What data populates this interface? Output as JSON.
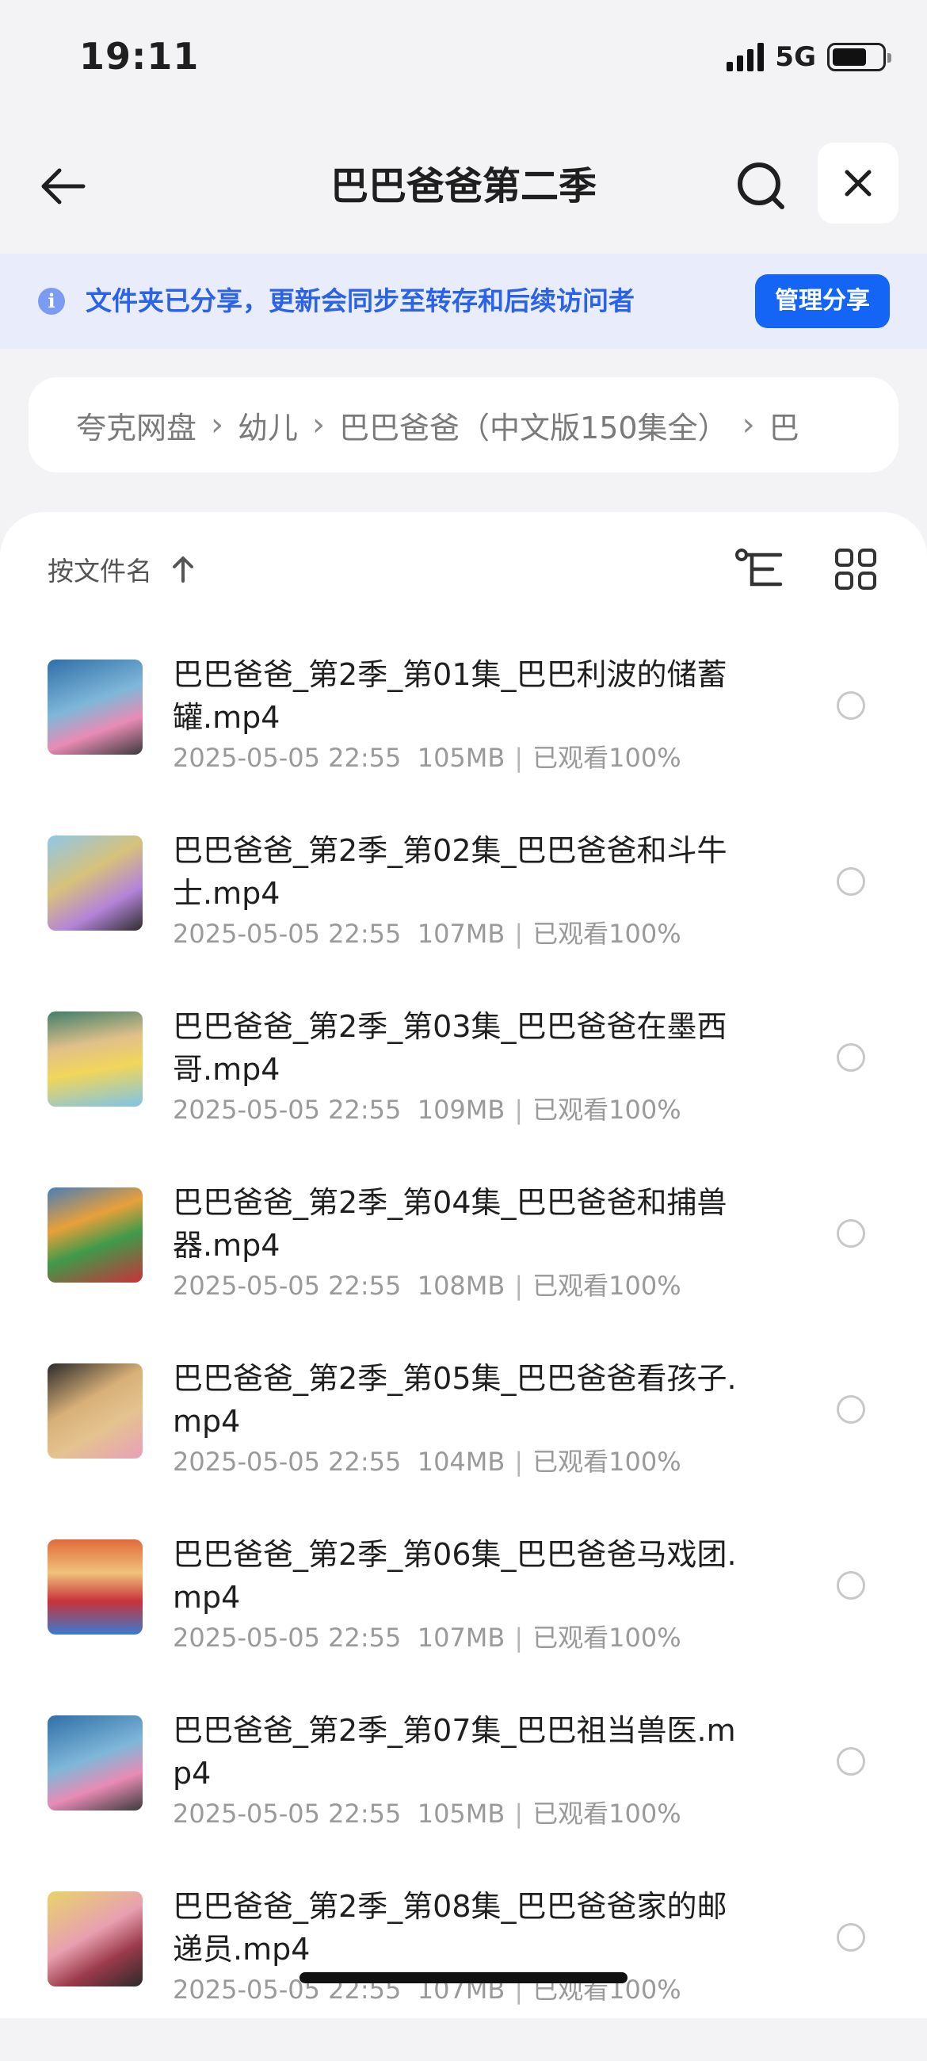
{
  "status": {
    "time": "19:11",
    "network": "5G",
    "battery_level": 0.7
  },
  "nav": {
    "title": "巴巴爸爸第二季",
    "back_icon": "arrow-left-icon",
    "search_icon": "search-icon",
    "close_icon": "close-icon"
  },
  "banner": {
    "text": "文件夹已分享，更新会同步至转存和后续访问者",
    "button": "管理分享",
    "accent": "#1464f5"
  },
  "breadcrumb": {
    "items": [
      "夸克网盘",
      "幼儿",
      "巴巴爸爸（中文版150集全）",
      "巴"
    ]
  },
  "toolbar": {
    "sort_label": "按文件名"
  },
  "files": [
    {
      "name": "巴巴爸爸_第2季_第01集_巴巴利波的储蓄罐.mp4",
      "date": "2025-05-05 22:55",
      "size": "105MB",
      "progress": "已观看100%"
    },
    {
      "name": "巴巴爸爸_第2季_第02集_巴巴爸爸和斗牛士.mp4",
      "date": "2025-05-05 22:55",
      "size": "107MB",
      "progress": "已观看100%"
    },
    {
      "name": "巴巴爸爸_第2季_第03集_巴巴爸爸在墨西哥.mp4",
      "date": "2025-05-05 22:55",
      "size": "109MB",
      "progress": "已观看100%"
    },
    {
      "name": "巴巴爸爸_第2季_第04集_巴巴爸爸和捕兽器.mp4",
      "date": "2025-05-05 22:55",
      "size": "108MB",
      "progress": "已观看100%"
    },
    {
      "name": "巴巴爸爸_第2季_第05集_巴巴爸爸看孩子.mp4",
      "date": "2025-05-05 22:55",
      "size": "104MB",
      "progress": "已观看100%"
    },
    {
      "name": "巴巴爸爸_第2季_第06集_巴巴爸爸马戏团.mp4",
      "date": "2025-05-05 22:55",
      "size": "107MB",
      "progress": "已观看100%"
    },
    {
      "name": "巴巴爸爸_第2季_第07集_巴巴祖当兽医.mp4",
      "date": "2025-05-05 22:55",
      "size": "105MB",
      "progress": "已观看100%"
    },
    {
      "name": "巴巴爸爸_第2季_第08集_巴巴爸爸家的邮递员.mp4",
      "date": "2025-05-05 22:55",
      "size": "107MB",
      "progress": "已观看100%"
    }
  ]
}
